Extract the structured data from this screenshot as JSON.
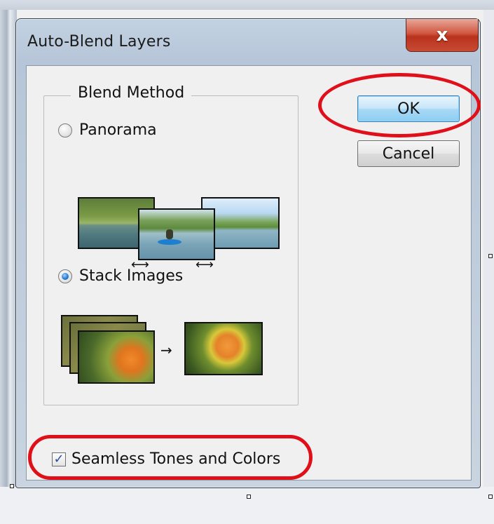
{
  "dialog": {
    "title": "Auto-Blend Layers",
    "close_glyph": "x",
    "blend_method": {
      "legend": "Blend Method",
      "options": [
        {
          "label": "Panorama",
          "selected": false
        },
        {
          "label": "Stack Images",
          "selected": true
        }
      ]
    },
    "buttons": {
      "ok_label": "OK",
      "cancel_label": "Cancel"
    },
    "seamless": {
      "label": "Seamless Tones and Colors",
      "checked": true,
      "check_glyph": "✓"
    },
    "arrows": {
      "pano_left": "⟷",
      "pano_right": "⟷",
      "stack": "→"
    }
  },
  "colors": {
    "annotation": "#e0101a",
    "ok_button": "#a9d9f6",
    "close_button": "#c94a33"
  },
  "icons": [
    "close-icon",
    "panorama-illustration",
    "stack-images-illustration",
    "checkmark-icon"
  ]
}
